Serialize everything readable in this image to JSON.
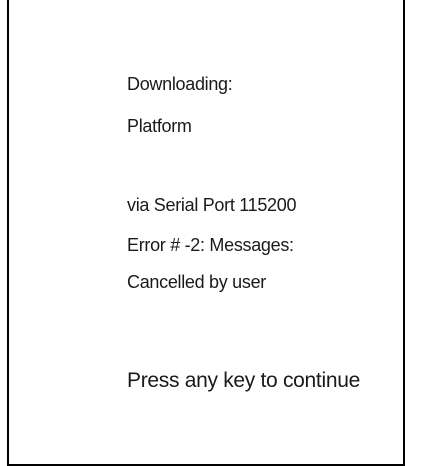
{
  "status": {
    "downloading_label": "Downloading:",
    "target": "Platform",
    "connection": "via Serial Port 115200",
    "error_line": "Error # -2: Messages:",
    "error_detail": "Cancelled by user"
  },
  "prompt": {
    "text": "Press any key to continue"
  }
}
